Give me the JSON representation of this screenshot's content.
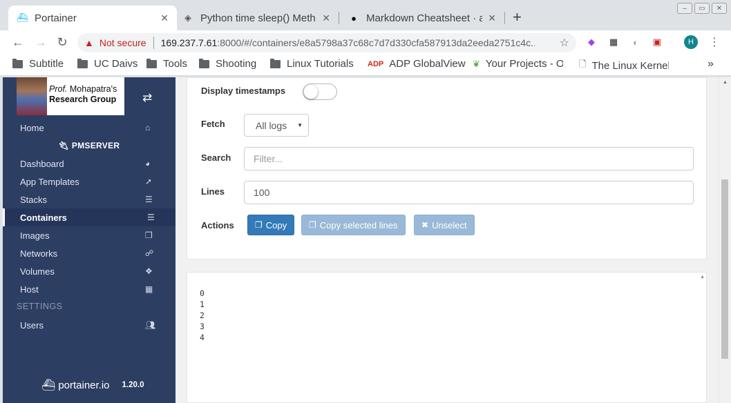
{
  "browser": {
    "tabs": [
      {
        "title": "Portainer",
        "icon": "portainer-icon",
        "active": true
      },
      {
        "title": "Python time sleep() Meth",
        "icon": "diamond-icon",
        "active": false
      },
      {
        "title": "Markdown Cheatsheet · a",
        "icon": "github-icon",
        "active": false
      }
    ],
    "new_tab": "+",
    "address": {
      "security": "Not secure",
      "host": "169.237.7.61",
      "path": ":8000/#/containers/e8a5798a37c68c7d7d330cfa587913da2eeda2751c4c..."
    },
    "profile_initial": "H",
    "bookmarks": [
      {
        "label": "Subtitle",
        "icon": "folder-icon"
      },
      {
        "label": "UC Daivs",
        "icon": "folder-icon"
      },
      {
        "label": "Tools",
        "icon": "folder-icon"
      },
      {
        "label": "Shooting",
        "icon": "folder-icon"
      },
      {
        "label": "Linux Tutorials",
        "icon": "folder-icon"
      },
      {
        "label": "ADP GlobalView",
        "icon": "adp-icon"
      },
      {
        "label": "Your Projects - O",
        "icon": "overleaf-icon"
      },
      {
        "label": "The Linux Kernel",
        "icon": "page-icon"
      }
    ],
    "bookmarks_more": "»"
  },
  "sidebar": {
    "logo": {
      "prefix": "Prof.",
      "name": " Mohapatra's",
      "line2": "Research Group"
    },
    "home": "Home",
    "endpoint": "PMSERVER",
    "items": [
      {
        "label": "Dashboard",
        "icon": "tachometer-icon"
      },
      {
        "label": "App Templates",
        "icon": "rocket-icon"
      },
      {
        "label": "Stacks",
        "icon": "th-list-icon"
      },
      {
        "label": "Containers",
        "icon": "server-icon",
        "active": true
      },
      {
        "label": "Images",
        "icon": "clone-icon"
      },
      {
        "label": "Networks",
        "icon": "sitemap-icon"
      },
      {
        "label": "Volumes",
        "icon": "cubes-icon"
      },
      {
        "label": "Host",
        "icon": "th-icon"
      }
    ],
    "settings_header": "SETTINGS",
    "users": "Users",
    "footer": {
      "brand": "portainer.io",
      "version": "1.20.0"
    }
  },
  "logs": {
    "timestamps_label": "Display timestamps",
    "timestamps_on": false,
    "fetch_label": "Fetch",
    "fetch_value": "All logs",
    "search_label": "Search",
    "search_placeholder": "Filter...",
    "lines_label": "Lines",
    "lines_value": "100",
    "actions_label": "Actions",
    "copy_label": "Copy",
    "copy_selected_label": "Copy selected lines",
    "unselect_label": "Unselect",
    "output": [
      "0",
      "1",
      "2",
      "3",
      "4"
    ]
  },
  "colors": {
    "sidebar": "#2d3e63",
    "primary": "#337ab7",
    "disabled_button": "#9ab9d8",
    "not_secure": "#c5221f"
  }
}
